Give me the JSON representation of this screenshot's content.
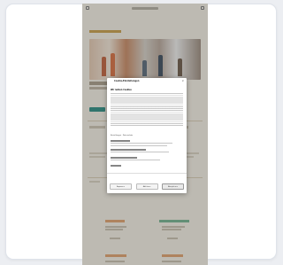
{
  "dialog": {
    "title": "Cookie-Einstellungen",
    "heading": "Wir nutzen Cookies",
    "settings_link": "Einstellungen · Datenschutz",
    "buttons": {
      "settings": "Anpassen",
      "reject": "Ablehnen",
      "accept": "Akzeptieren"
    }
  },
  "colors": {
    "page_bg": "#f5f1e6",
    "accent_teal": "#2c8d83",
    "accent_orange": "#d9823a",
    "accent_green": "#3f9a6b"
  }
}
